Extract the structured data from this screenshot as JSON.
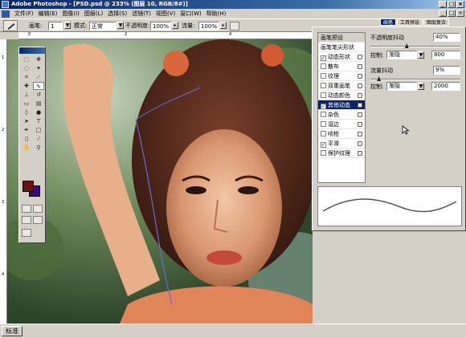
{
  "window": {
    "title": "Adobe Photoshop - [PSD.psd @ 233% (图层 10, RGB/8#)]",
    "min": "_",
    "max": "□",
    "close": "×"
  },
  "menu": [
    "文件(F)",
    "编辑(E)",
    "图像(I)",
    "图层(L)",
    "选择(S)",
    "滤镜(T)",
    "视图(V)",
    "窗口(W)",
    "帮助(H)"
  ],
  "options": {
    "brush_label": "画笔:",
    "brush_size": "1",
    "mode_label": "模式:",
    "mode_value": "正常",
    "opacity_label": "不透明度:",
    "opacity_value": "100%",
    "flow_label": "流量:",
    "flow_value": "100%"
  },
  "palette_well": {
    "tabs": [
      "画笔",
      "工具预设",
      "图层复合"
    ]
  },
  "ruler": {
    "top_ticks": [
      "0",
      "2",
      "4"
    ],
    "left_ticks": [
      "1",
      "2",
      "3",
      "4"
    ]
  },
  "colors": {
    "foreground": "#6b1414",
    "background": "#3a0d7a",
    "accent": "#0a246a"
  },
  "brush_panel": {
    "header": "画笔预设",
    "tip_shape": "画笔笔尖形状",
    "options": [
      {
        "label": "动态形状",
        "checked": true,
        "selected": false
      },
      {
        "label": "散布",
        "checked": false,
        "selected": false
      },
      {
        "label": "纹理",
        "checked": false,
        "selected": false
      },
      {
        "label": "双重画笔",
        "checked": false,
        "selected": false
      },
      {
        "label": "动态颜色",
        "checked": false,
        "selected": false
      },
      {
        "label": "其他动态",
        "checked": true,
        "selected": true
      },
      {
        "label": "杂色",
        "checked": false,
        "selected": false
      },
      {
        "label": "湿边",
        "checked": false,
        "selected": false
      },
      {
        "label": "喷枪",
        "checked": false,
        "selected": false
      },
      {
        "label": "平滑",
        "checked": true,
        "selected": false
      },
      {
        "label": "保护纹理",
        "checked": false,
        "selected": false
      }
    ],
    "opacity_jitter_label": "不透明度抖动",
    "opacity_jitter_value": "40%",
    "opacity_jitter_level": 0.4,
    "control_label": "控制:",
    "control1_value": "渐隐",
    "control1_steps": "800",
    "flow_jitter_label": "流量抖动",
    "flow_jitter_value": "9%",
    "flow_jitter_level": 0.09,
    "control2_value": "渐隐",
    "control2_steps": "2000"
  },
  "status": {
    "taskbar_label": "标准"
  }
}
